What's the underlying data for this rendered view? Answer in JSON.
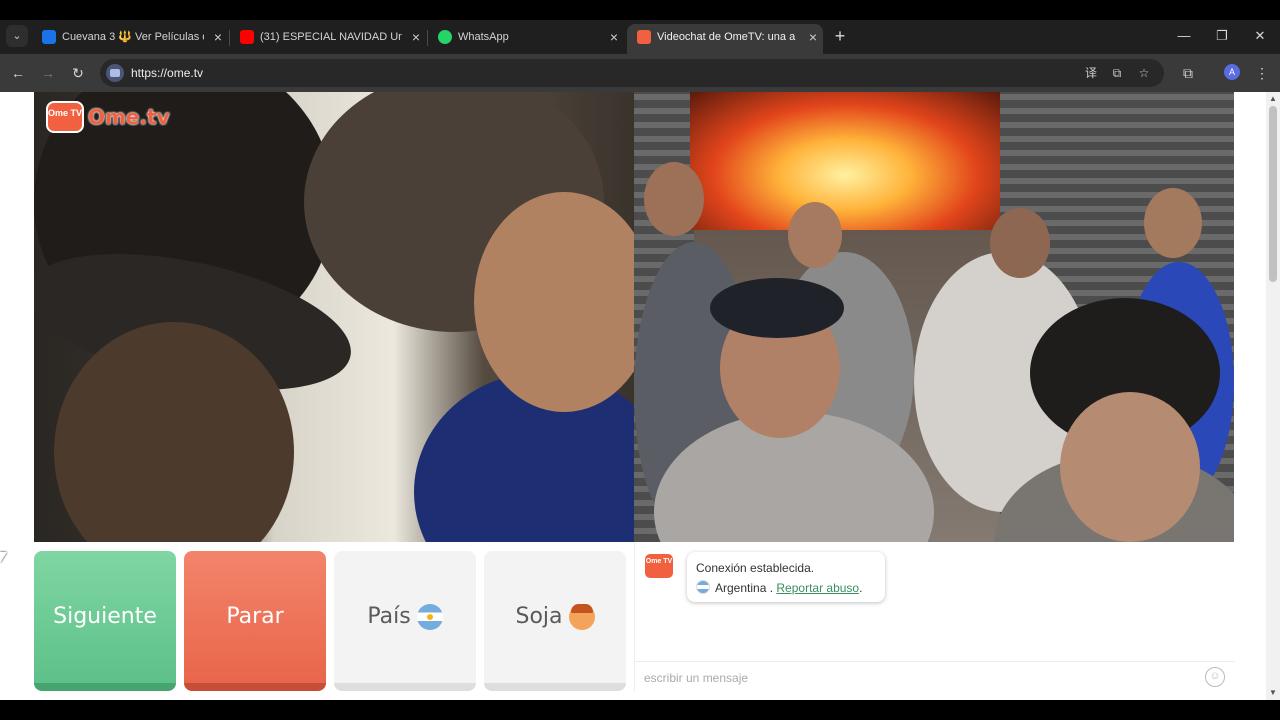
{
  "browser": {
    "tab_search_icon": "chevron-down-icon",
    "tabs": [
      {
        "title": "Cuevana 3 🔱 Ver Películas o Se",
        "favicon_color": "#1a73e8",
        "active": false
      },
      {
        "title": "(31) ESPECIAL NAVIDAD Un Poc",
        "favicon_color": "#ff0000",
        "active": false
      },
      {
        "title": "WhatsApp",
        "favicon_color": "#25d366",
        "active": false
      },
      {
        "title": "Videochat de OmeTV: una a",
        "favicon_color": "#f1603f",
        "active": true
      }
    ],
    "new_tab_label": "+",
    "window": {
      "minimize": "—",
      "restore": "❐",
      "close": "✕"
    },
    "nav": {
      "back": "←",
      "forward": "→",
      "reload": "↻"
    },
    "url": "https://ome.tv",
    "omnibox_actions": {
      "translate": "译",
      "cast": "⧉",
      "bookmark": "☆"
    },
    "extensions_icon": "⧉",
    "profile_initial": "A",
    "menu_icon": "⋮"
  },
  "page": {
    "logo": {
      "badge": "Ome TV",
      "text": "Ome.tv"
    },
    "controls": {
      "next_label": "Siguiente",
      "stop_label": "Parar",
      "country_label": "País",
      "gender_label": "Soja"
    },
    "chat": {
      "logo_badge": "Ome TV",
      "connection_status": "Conexión establecida.",
      "country": "Argentina .",
      "report_link": "Reportar abuso",
      "report_suffix": ".",
      "message_placeholder": "escribir un mensaje",
      "emoji_icon": "☺"
    }
  },
  "colors": {
    "accent": "#f1603f",
    "next_button": "#5ec189",
    "stop_button": "#e9664b",
    "link": "#3a8f5e"
  }
}
